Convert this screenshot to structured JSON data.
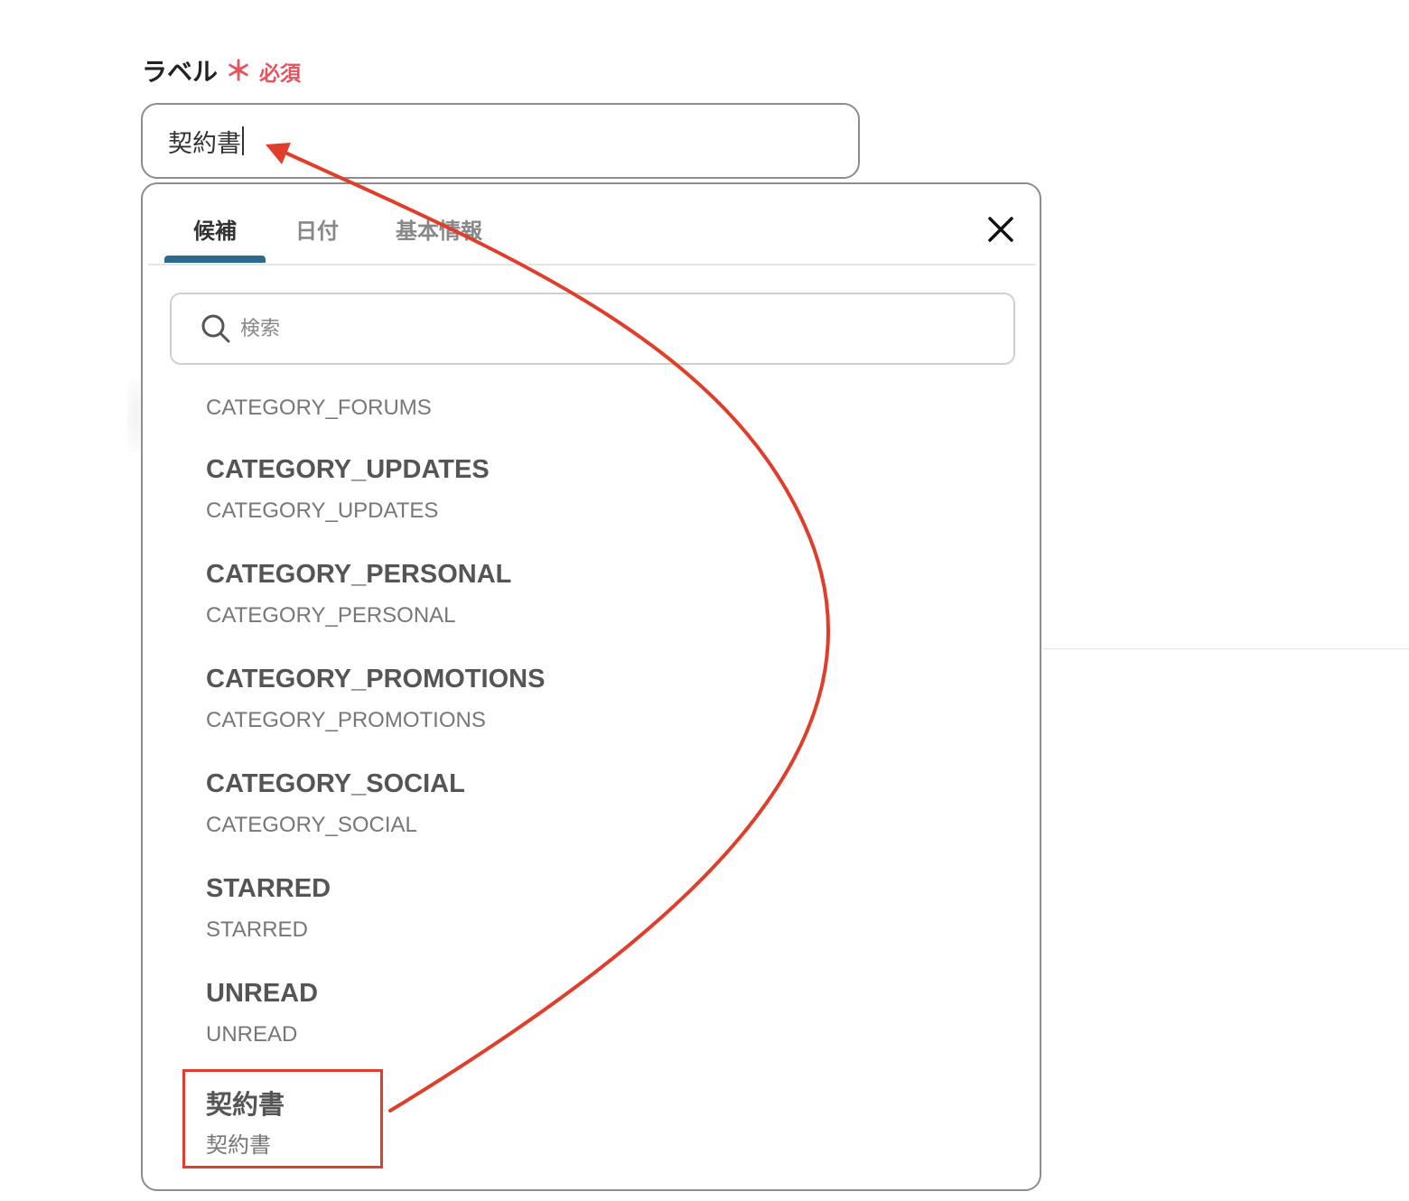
{
  "field": {
    "label": "ラベル",
    "required_mark": "＊",
    "required_text": "必須",
    "value": "契約書"
  },
  "dropdown": {
    "tabs": [
      {
        "label": "候補",
        "active": true
      },
      {
        "label": "日付",
        "active": false
      },
      {
        "label": "基本情報",
        "active": false
      }
    ],
    "close_icon": "close-icon",
    "search": {
      "placeholder": "検索",
      "icon": "search-icon"
    },
    "options_partial_sub": "CATEGORY_FORUMS",
    "options": [
      {
        "title": "CATEGORY_UPDATES",
        "sub": "CATEGORY_UPDATES"
      },
      {
        "title": "CATEGORY_PERSONAL",
        "sub": "CATEGORY_PERSONAL"
      },
      {
        "title": "CATEGORY_PROMOTIONS",
        "sub": "CATEGORY_PROMOTIONS"
      },
      {
        "title": "CATEGORY_SOCIAL",
        "sub": "CATEGORY_SOCIAL"
      },
      {
        "title": "STARRED",
        "sub": "STARRED"
      },
      {
        "title": "UNREAD",
        "sub": "UNREAD"
      },
      {
        "title": "契約書",
        "sub": "契約書"
      }
    ]
  },
  "colors": {
    "required": "#e5545c",
    "tab_indicator": "#2d6a8f",
    "annotation": "#e03e2a"
  }
}
